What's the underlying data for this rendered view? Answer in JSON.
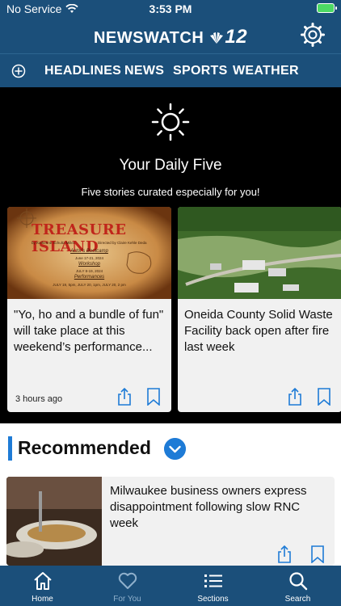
{
  "status": {
    "carrier": "No Service",
    "time": "3:53 PM"
  },
  "header": {
    "logo_text": "NEWSWATCH",
    "logo_number": "12"
  },
  "nav": {
    "items": [
      "HEADLINES",
      "NEWS",
      "SPORTS",
      "WEATHER"
    ]
  },
  "daily": {
    "title": "Your Daily Five",
    "subtitle": "Five stories curated especially for you!",
    "cards": [
      {
        "title": "\"Yo, ho and a bundle of fun\" will take place at this weekend’s performance...",
        "time": "3 hours ago",
        "image": {
          "heading": "TREASURE ISLAND",
          "byline": "by Katherine Schultz Miller",
          "director": "Directed by Claire Kehle Deda",
          "line1": "Actor's Bootcamp",
          "line2": "June 17-21, 2024",
          "line3": "Workshop",
          "line4": "JULY 8-19, 2024",
          "line5": "Performances",
          "line6": "JULY 19, 5pm, JULY 20, 1pm, JULY 20, 2 pm"
        }
      },
      {
        "title": "Oneida County Solid Waste Facility back open after fire last week",
        "time": ""
      }
    ]
  },
  "recommended": {
    "title": "Recommended",
    "story": {
      "title": "Milwaukee business owners express disappointment following slow RNC week"
    }
  },
  "tabs": [
    {
      "label": "Home",
      "icon": "home-icon",
      "active": true
    },
    {
      "label": "For You",
      "icon": "heart-icon",
      "active": false
    },
    {
      "label": "Sections",
      "icon": "list-icon",
      "active": true
    },
    {
      "label": "Search",
      "icon": "search-icon",
      "active": true
    }
  ],
  "colors": {
    "brand": "#1b4f7a",
    "accent": "#1e7bd6",
    "daily_bg": "#000000",
    "card_bg": "#f1f1f1"
  }
}
